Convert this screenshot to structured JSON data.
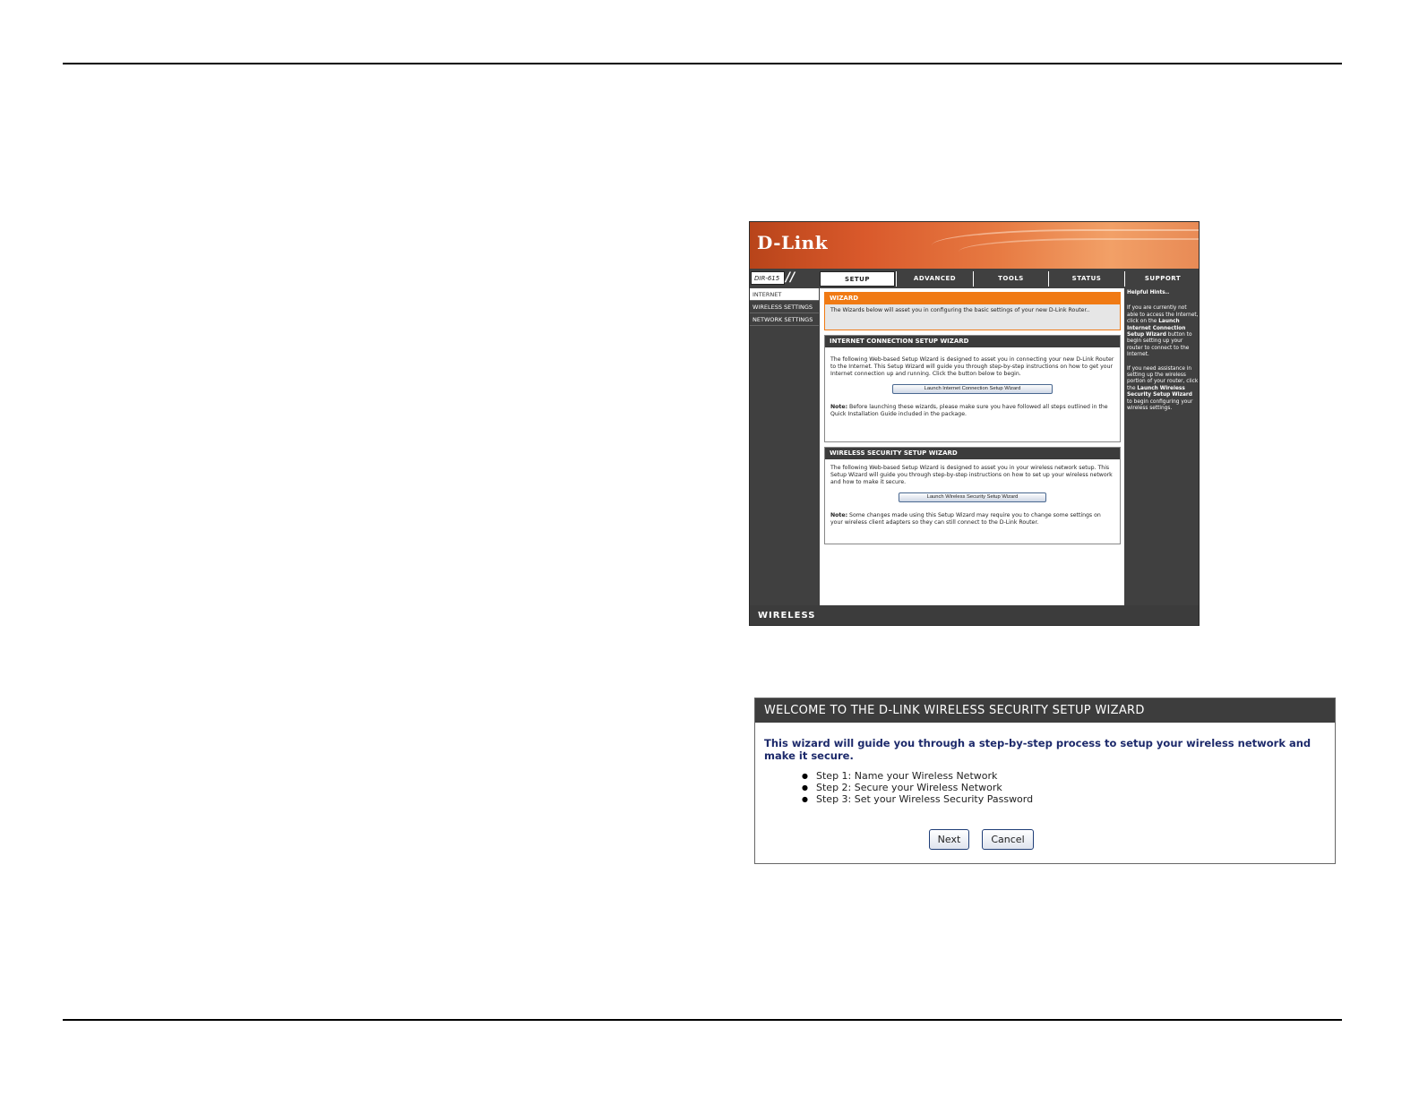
{
  "router": {
    "logo": "D-Link",
    "model": "DIR-615",
    "tabs": [
      {
        "label": "SETUP",
        "active": true
      },
      {
        "label": "ADVANCED",
        "active": false
      },
      {
        "label": "TOOLS",
        "active": false
      },
      {
        "label": "STATUS",
        "active": false
      },
      {
        "label": "SUPPORT",
        "active": false
      }
    ],
    "sidebar": {
      "items": [
        {
          "label": "INTERNET"
        },
        {
          "label": "WIRELESS SETTINGS"
        },
        {
          "label": "NETWORK SETTINGS"
        }
      ]
    },
    "wizard_box": {
      "title": "WIZARD",
      "text": "The Wizards below will asset you in configuring the basic settings of your new D-Link Router.."
    },
    "internet_box": {
      "title": "INTERNET CONNECTION SETUP WIZARD",
      "text": "The following Web-based Setup Wizard is designed to asset you in connecting your new D-Link Router to the Internet. This Setup Wizard will guide you through step-by-step instructions on how to get your Internet connection up and running. Click the button below to begin.",
      "button": "Launch Internet Connection Setup Wizard",
      "note_label": "Note:",
      "note": " Before launching these wizards, please make sure you have followed all steps outlined in the Quick Installation Guide included in the package."
    },
    "wireless_box": {
      "title": "WIRELESS SECURITY SETUP WIZARD",
      "text": "The following Web-based Setup Wizard is designed to asset you in your wireless network setup. This Setup Wizard will guide you through step-by-step instructions on how to set up your wireless network and how to make it secure.",
      "button": "Launch Wireless Security Setup Wizard",
      "note_label": "Note:",
      "note": " Some changes made using this Setup Wizard may require you to change some settings on your wireless client adapters so they can still connect to the D-Link Router."
    },
    "hints": {
      "title": "Helpful Hints..",
      "p1_a": "If you are currently not able to access the Internet, click on the ",
      "p1_b": "Launch Internet Connection Setup Wizard",
      "p1_c": " button to begin setting up your router to connect to the Internet.",
      "p2_a": "If you need assistance in setting up the wireless portion of your router, click the ",
      "p2_b": "Launch Wireless Security Setup Wizard",
      "p2_c": " to begin configuring your wireless settings."
    },
    "footer": "WIRELESS"
  },
  "wizard_dialog": {
    "title": "WELCOME TO THE D-LINK WIRELESS SECURITY SETUP WIZARD",
    "intro": "This wizard will guide you through a step-by-step process to setup your wireless network and make it secure.",
    "steps": [
      "Step 1: Name your Wireless Network",
      "Step 2: Secure your Wireless Network",
      "Step 3: Set your Wireless Security Password"
    ],
    "next_label": "Next",
    "cancel_label": "Cancel"
  }
}
